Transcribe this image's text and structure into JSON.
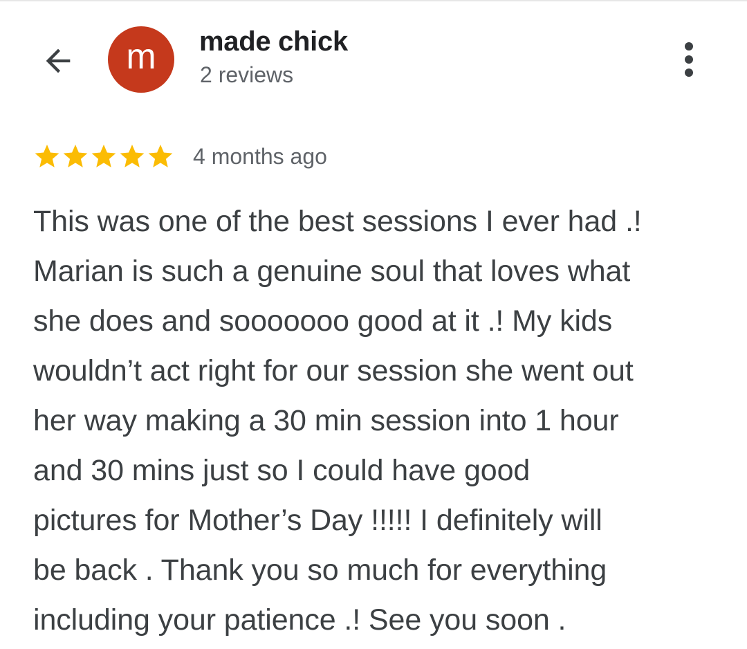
{
  "header": {
    "back_icon": "arrow-left-icon",
    "avatar_letter": "m",
    "avatar_color": "#c5391c",
    "reviewer_name": "made chick",
    "review_count": "2 reviews",
    "more_icon": "more-vert-icon"
  },
  "review": {
    "rating": 5,
    "rating_max": 5,
    "star_color": "#fbbc04",
    "time": "4 months ago",
    "lines": [
      "This was one of the best sessions I ever had .!",
      "Marian is such a genuine soul that loves what",
      "she does and sooooooo good at it .! My kids",
      "wouldn’t act right for our session she went out",
      "her way making a 30 min session into 1 hour",
      "and 30 mins just so I could have good",
      "pictures for Mother’s Day !!!!! I definitely will",
      "be back . Thank you so much for everything",
      "including your patience .! See you soon ."
    ]
  }
}
